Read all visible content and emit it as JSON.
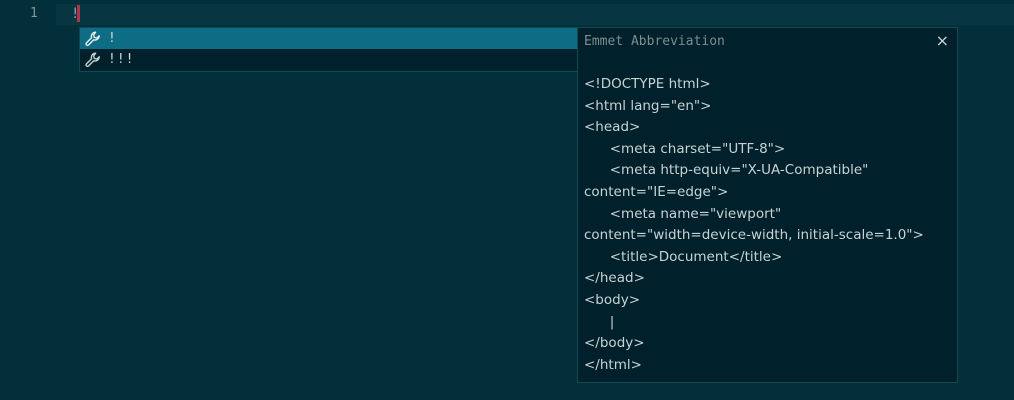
{
  "editor": {
    "line_number": "1",
    "line_text": "!"
  },
  "suggestions": [
    {
      "icon": "wrench-icon",
      "label": "!"
    },
    {
      "icon": "wrench-icon",
      "label": "!!!"
    }
  ],
  "details": {
    "title": "Emmet Abbreviation",
    "close_label": "×",
    "snippet_lines": [
      "<!DOCTYPE html>",
      "<html lang=\"en\">",
      "<head>",
      "      <meta charset=\"UTF-8\">",
      "      <meta http-equiv=\"X-UA-Compatible\"",
      "content=\"IE=edge\">",
      "      <meta name=\"viewport\"",
      "content=\"width=device-width, initial-scale=1.0\">",
      "      <title>Document</title>",
      "</head>",
      "<body>",
      "      |",
      "</body>",
      "</html>"
    ]
  },
  "colors": {
    "background": "#022f3a",
    "selection": "#0e6d84",
    "caret": "#b1344e",
    "panel": "#00212b"
  }
}
